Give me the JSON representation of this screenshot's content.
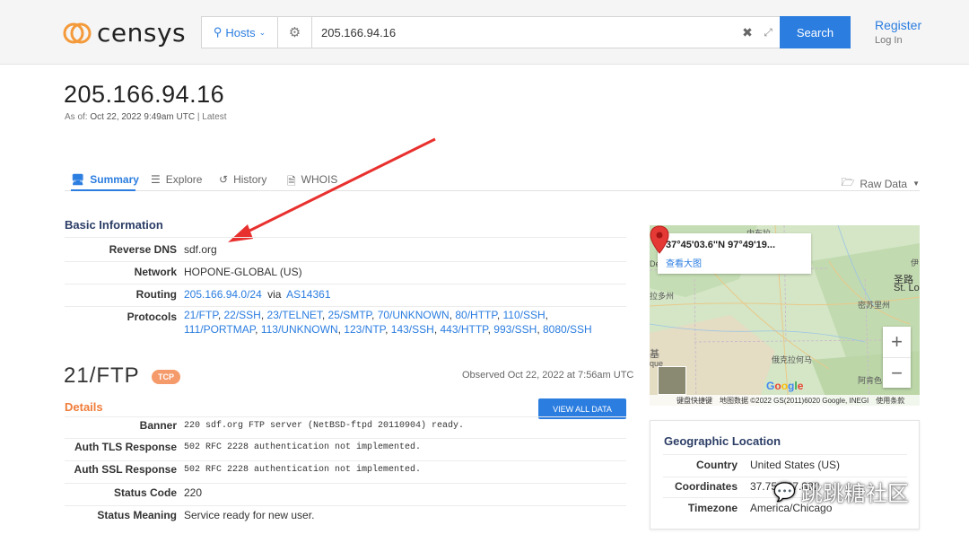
{
  "header": {
    "logo_text": "censys",
    "search_type": "Hosts",
    "search_value": "205.166.94.16",
    "search_button": "Search",
    "register": "Register",
    "login": "Log In"
  },
  "host": {
    "ip": "205.166.94.16",
    "as_of_prefix": "As of:",
    "as_of_date": "Oct 22, 2022 9:49am UTC",
    "as_of_suffix": "| Latest"
  },
  "tabs": [
    {
      "label": "Summary",
      "icon": "monitor-icon",
      "active": true
    },
    {
      "label": "Explore",
      "icon": "binoculars-icon",
      "active": false
    },
    {
      "label": "History",
      "icon": "history-icon",
      "active": false
    },
    {
      "label": "WHOIS",
      "icon": "document-icon",
      "active": false
    }
  ],
  "raw_data": "Raw Data",
  "basic_info": {
    "title": "Basic Information",
    "reverse_dns_label": "Reverse DNS",
    "reverse_dns": "sdf.org",
    "network_label": "Network",
    "network": "HOPONE-GLOBAL (US)",
    "routing_label": "Routing",
    "routing_prefix": "205.166.94.0/24",
    "routing_via": "via",
    "routing_as": "AS14361",
    "protocols_label": "Protocols",
    "protocols": [
      "21/FTP",
      "22/SSH",
      "23/TELNET",
      "25/SMTP",
      "70/UNKNOWN",
      "80/HTTP",
      "110/SSH",
      "111/PORTMAP",
      "113/UNKNOWN",
      "123/NTP",
      "143/SSH",
      "443/HTTP",
      "993/SSH",
      "8080/SSH"
    ]
  },
  "service": {
    "title": "21/FTP",
    "transport": "TCP",
    "observed": "Observed Oct 22, 2022 at 7:56am UTC",
    "details_title": "Details",
    "view_all": "VIEW ALL DATA",
    "rows": [
      {
        "label": "Banner",
        "value": "220 sdf.org FTP server (NetBSD-ftpd 20110904) ready.",
        "mono": true
      },
      {
        "label": "Auth TLS Response",
        "value": "502 RFC 2228 authentication not implemented.",
        "mono": true
      },
      {
        "label": "Auth SSL Response",
        "value": "502 RFC 2228 authentication not implemented.",
        "mono": true
      },
      {
        "label": "Status Code",
        "value": "220",
        "mono": false
      },
      {
        "label": "Status Meaning",
        "value": "Service ready for new user.",
        "mono": false
      }
    ]
  },
  "map": {
    "coords": "37°45'03.6\"N 97°49'19...",
    "larger_map": "查看大图",
    "google": "Google",
    "footer": [
      "键盘快捷键",
      "地图数据 ©2022 GS(2011)6020 Google, INEGI",
      "使用条款"
    ],
    "labels": {
      "xixi": "内布拉",
      "yi": "伊",
      "de": "De",
      "sheng": "圣路",
      "stl": "St. Lo",
      "lasi": "拉多州",
      "misuli": "密苏里州",
      "ji": "基",
      "que": "que",
      "ekla": "俄克拉何马",
      "aken": "阿肯色"
    }
  },
  "geo": {
    "title": "Geographic Location",
    "country_label": "Country",
    "country": "United States (US)",
    "coords_label": "Coordinates",
    "coords": "37.75, -97.822",
    "timezone_label": "Timezone",
    "timezone": "America/Chicago"
  },
  "watermark": "跳跳糖社区",
  "colors": {
    "accent": "#2b7de0",
    "heading": "#2c3e66",
    "orange": "#f07d3a",
    "badge": "#f59a6a",
    "arrow": "#e8312e"
  }
}
